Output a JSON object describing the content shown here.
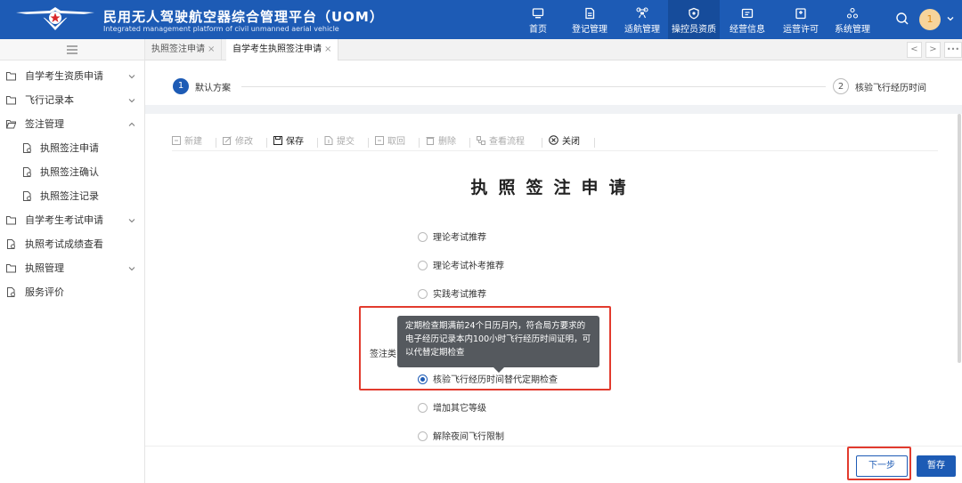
{
  "header": {
    "title": "民用无人驾驶航空器综合管理平台（UOM）",
    "subtitle": "Integrated management platform of civil unmanned aerial vehicle",
    "nav": [
      {
        "label": "首页",
        "icon": "monitor-icon"
      },
      {
        "label": "登记管理",
        "icon": "document-icon"
      },
      {
        "label": "适航管理",
        "icon": "drone-icon"
      },
      {
        "label": "操控员资质",
        "icon": "shield-icon"
      },
      {
        "label": "经营信息",
        "icon": "card-icon"
      },
      {
        "label": "运营许可",
        "icon": "badge-icon"
      },
      {
        "label": "系统管理",
        "icon": "cluster-icon"
      }
    ],
    "active_nav": "操控员资质",
    "avatar_text": "1",
    "colors": {
      "primary": "#1d5bb5",
      "active_nav": "#164c9b",
      "highlight": "#e23b2e"
    }
  },
  "sidebar": {
    "items": [
      {
        "label": "自学考生资质申请",
        "icon": "folder-icon",
        "arrow": "chevron-down-icon"
      },
      {
        "label": "飞行记录本",
        "icon": "folder-icon",
        "arrow": "chevron-down-icon"
      },
      {
        "label": "签注管理",
        "icon": "folder-open-icon",
        "arrow": "chevron-up-icon"
      },
      {
        "label": "执照签注申请",
        "icon": "file-icon"
      },
      {
        "label": "执照签注确认",
        "icon": "file-icon"
      },
      {
        "label": "执照签注记录",
        "icon": "file-icon"
      },
      {
        "label": "自学考生考试申请",
        "icon": "folder-icon",
        "arrow": "chevron-down-icon"
      },
      {
        "label": "执照考试成绩查看",
        "icon": "file-icon"
      },
      {
        "label": "执照管理",
        "icon": "folder-icon",
        "arrow": "chevron-down-icon"
      },
      {
        "label": "服务评价",
        "icon": "file-icon"
      }
    ]
  },
  "tabs": [
    {
      "label": "执照签注申请",
      "close": "×"
    },
    {
      "label": "自学考生执照签注申请",
      "close": "×"
    }
  ],
  "tab_nav": {
    "prev": "<",
    "next": ">",
    "more": "•••"
  },
  "steps": [
    {
      "num": "1",
      "label": "默认方案"
    },
    {
      "num": "2",
      "label": "核验飞行经历时间"
    }
  ],
  "toolbar": [
    {
      "label": "新建"
    },
    {
      "label": "修改"
    },
    {
      "label": "保存"
    },
    {
      "label": "提交"
    },
    {
      "label": "取回"
    },
    {
      "label": "删除"
    },
    {
      "label": "查看流程"
    },
    {
      "label": "关闭"
    }
  ],
  "form": {
    "title": "执照签注申请",
    "field_label": "签注类",
    "options": [
      {
        "label": "理论考试推荐",
        "checked": false
      },
      {
        "label": "理论考试补考推荐",
        "checked": false
      },
      {
        "label": "实践考试推荐",
        "checked": false
      },
      {
        "label": "核验飞行经历时间替代定期检查",
        "checked": true
      },
      {
        "label": "增加其它等级",
        "checked": false
      },
      {
        "label": "解除夜间飞行限制",
        "checked": false
      }
    ],
    "tooltip": "定期检查期满前24个日历月内，符合局方要求的电子经历记录本内100小时飞行经历时间证明，可以代替定期检查"
  },
  "footer": {
    "next_label": "下一步",
    "save_label": "暂存"
  }
}
